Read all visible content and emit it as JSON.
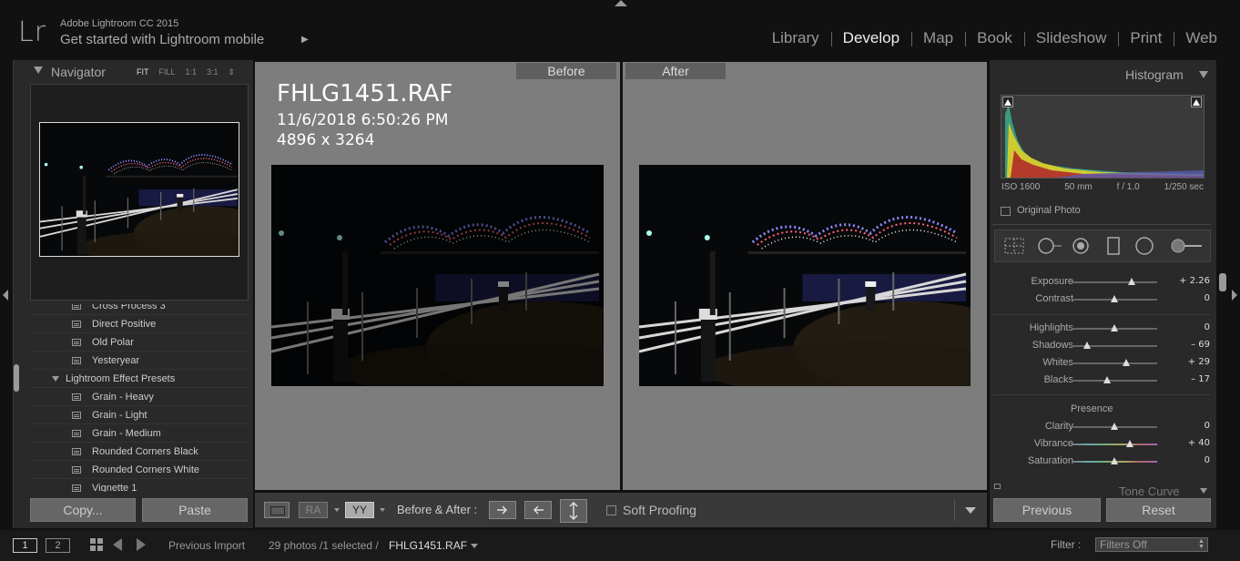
{
  "app": {
    "logo": "Lr",
    "name": "Adobe Lightroom CC 2015",
    "mobile_prompt": "Get started with Lightroom mobile",
    "mobile_arrow": "▶"
  },
  "modules": [
    {
      "label": "Library",
      "active": false
    },
    {
      "label": "Develop",
      "active": true
    },
    {
      "label": "Map",
      "active": false
    },
    {
      "label": "Book",
      "active": false
    },
    {
      "label": "Slideshow",
      "active": false
    },
    {
      "label": "Print",
      "active": false
    },
    {
      "label": "Web",
      "active": false
    }
  ],
  "navigator": {
    "title": "Navigator",
    "options": [
      "FIT",
      "FILL",
      "1:1",
      "3:1"
    ],
    "selected_option": "FIT",
    "options_arrow": "⇕"
  },
  "presets": [
    {
      "label": "Cross Process 3",
      "type": "preset"
    },
    {
      "label": "Direct Positive",
      "type": "preset"
    },
    {
      "label": "Old Polar",
      "type": "preset"
    },
    {
      "label": "Yesteryear",
      "type": "preset"
    },
    {
      "label": "Lightroom Effect Presets",
      "type": "folder"
    },
    {
      "label": "Grain - Heavy",
      "type": "preset"
    },
    {
      "label": "Grain - Light",
      "type": "preset"
    },
    {
      "label": "Grain - Medium",
      "type": "preset"
    },
    {
      "label": "Rounded Corners Black",
      "type": "preset"
    },
    {
      "label": "Rounded Corners White",
      "type": "preset"
    },
    {
      "label": "Vignette 1",
      "type": "preset"
    }
  ],
  "left_buttons": {
    "copy": "Copy...",
    "paste": "Paste"
  },
  "compare": {
    "before_label": "Before",
    "after_label": "After",
    "file_name": "FHLG1451.RAF",
    "capture_date": "11/6/2018 6:50:26 PM",
    "dimensions": "4896 x 3264"
  },
  "toolbar": {
    "ra_label": "RA",
    "yy_label": "YY",
    "before_after_label": "Before & After :",
    "soft_proofing": "Soft Proofing",
    "soft_proofing_checked": false
  },
  "histogram": {
    "title": "Histogram",
    "iso": "ISO 1600",
    "focal": "50 mm",
    "aperture": "f / 1.0",
    "shutter": "1/250 sec",
    "original_photo": "Original Photo"
  },
  "adjustments": [
    {
      "label": "Exposure",
      "value": "+ 2.26",
      "position": 0.7
    },
    {
      "label": "Contrast",
      "value": "0",
      "position": 0.5
    },
    {
      "label": "Highlights",
      "value": "0",
      "position": 0.5
    },
    {
      "label": "Shadows",
      "value": "– 69",
      "position": 0.18
    },
    {
      "label": "Whites",
      "value": "+ 29",
      "position": 0.64
    },
    {
      "label": "Blacks",
      "value": "– 17",
      "position": 0.42
    }
  ],
  "presence": {
    "title": "Presence",
    "items": [
      {
        "label": "Clarity",
        "value": "0",
        "position": 0.5
      },
      {
        "label": "Vibrance",
        "value": "+ 40",
        "position": 0.68
      },
      {
        "label": "Saturation",
        "value": "0",
        "position": 0.5
      }
    ]
  },
  "next_panel": "Tone Curve",
  "right_buttons": {
    "previous": "Previous",
    "reset": "Reset"
  },
  "filmstrip": {
    "screen1": "1",
    "screen2": "2",
    "source": "Previous Import",
    "count": "29 photos /1 selected /",
    "file": "FHLG1451.RAF",
    "filter_label": "Filter :",
    "filter_value": "Filters Off"
  },
  "colors": {
    "panel_bg": "#292929",
    "canvas_gray": "#7d7d7d",
    "active_module": "#eeeeee"
  }
}
